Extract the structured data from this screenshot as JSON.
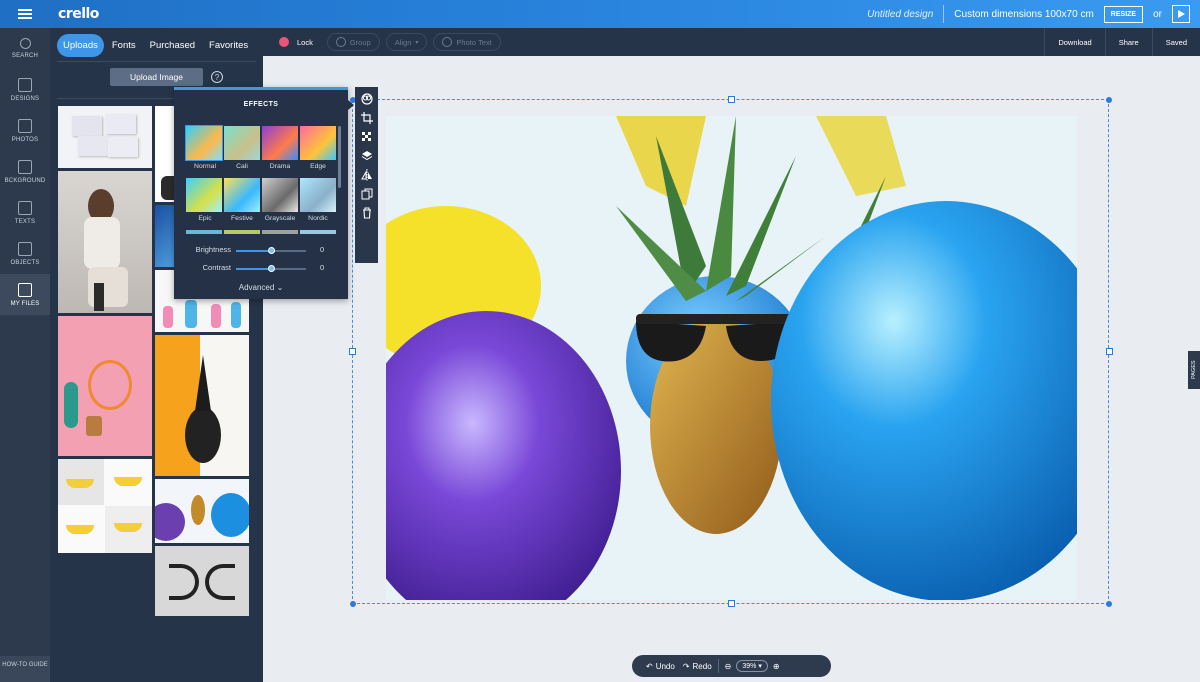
{
  "topbar": {
    "logo": "crello",
    "design_title": "Untitled design",
    "dimensions": "Custom dimensions 100x70 cm",
    "resize_label": "RESIZE",
    "or_label": "or"
  },
  "rail": {
    "items": [
      {
        "label": "SEARCH",
        "icon": "search-icon"
      },
      {
        "label": "DESIGNS",
        "icon": "designs-icon"
      },
      {
        "label": "PHOTOS",
        "icon": "photos-icon"
      },
      {
        "label": "BCKGROUND",
        "icon": "background-icon"
      },
      {
        "label": "TEXTS",
        "icon": "texts-icon"
      },
      {
        "label": "OBJECTS",
        "icon": "objects-icon"
      },
      {
        "label": "MY FILES",
        "icon": "my-files-icon"
      }
    ],
    "howto": "HOW-TO GUIDE"
  },
  "panel": {
    "tabs": [
      "Uploads",
      "Fonts",
      "Purchased",
      "Favorites"
    ],
    "upload_label": "Upload Image",
    "help": "?"
  },
  "toolbar": {
    "lock": "Lock",
    "group": "Group",
    "align": "Align",
    "photo_text": "Photo Text",
    "download": "Download",
    "share": "Share",
    "saved": "Saved"
  },
  "effects": {
    "title": "EFFECTS",
    "filters": [
      "Normal",
      "Cali",
      "Drama",
      "Edge",
      "Epic",
      "Festive",
      "Grayscale",
      "Nordic"
    ],
    "brightness_label": "Brightness",
    "brightness_value": "0",
    "contrast_label": "Contrast",
    "contrast_value": "0",
    "advanced_label": "Advanced"
  },
  "pages_label": "PAGES",
  "bottombar": {
    "undo": "Undo",
    "redo": "Redo",
    "zoom": "39%"
  },
  "colors": {
    "accent": "#3d96e8",
    "panel_bg": "#26344a",
    "rail_bg": "#2d3a4d"
  }
}
